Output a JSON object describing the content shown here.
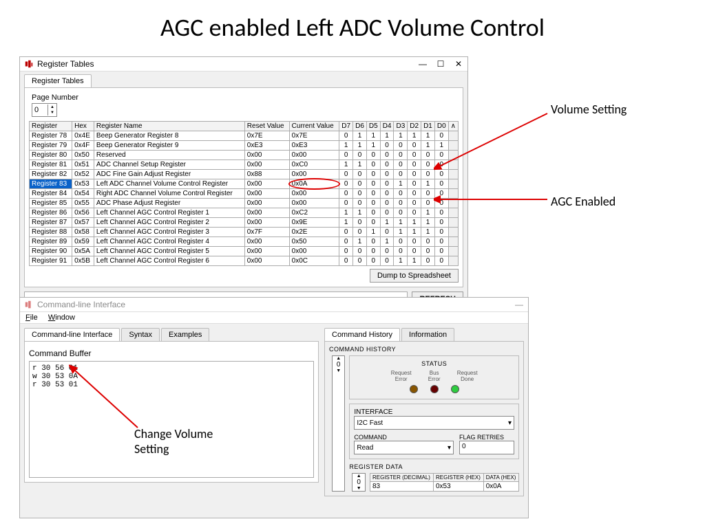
{
  "slide_title": "AGC enabled Left ADC Volume Control",
  "annotations": {
    "volume_setting": "Volume Setting",
    "agc_enabled": "AGC Enabled",
    "change_volume": "Change Volume Setting"
  },
  "reg_window": {
    "title": "Register Tables",
    "tab": "Register Tables",
    "page_label": "Page Number",
    "page_value": "0",
    "dump_btn": "Dump to Spreadsheet",
    "refresh_btn": "REFRESH",
    "columns": [
      "Register",
      "Hex",
      "Register Name",
      "Reset Value",
      "Current Value",
      "D7",
      "D6",
      "D5",
      "D4",
      "D3",
      "D2",
      "D1",
      "D0"
    ],
    "rows": [
      {
        "reg": "Register 78",
        "hex": "0x4E",
        "name": "Beep Generator Register 8",
        "reset": "0x7E",
        "cur": "0x7E",
        "bits": [
          "0",
          "1",
          "1",
          "1",
          "1",
          "1",
          "1",
          "0"
        ]
      },
      {
        "reg": "Register 79",
        "hex": "0x4F",
        "name": "Beep Generator Register 9",
        "reset": "0xE3",
        "cur": "0xE3",
        "bits": [
          "1",
          "1",
          "1",
          "0",
          "0",
          "0",
          "1",
          "1"
        ]
      },
      {
        "reg": "Register 80",
        "hex": "0x50",
        "name": "Reserved",
        "reset": "0x00",
        "cur": "0x00",
        "bits": [
          "0",
          "0",
          "0",
          "0",
          "0",
          "0",
          "0",
          "0"
        ]
      },
      {
        "reg": "Register 81",
        "hex": "0x51",
        "name": "ADC Channel Setup Register",
        "reset": "0x00",
        "cur": "0xC0",
        "bits": [
          "1",
          "1",
          "0",
          "0",
          "0",
          "0",
          "0",
          "0"
        ]
      },
      {
        "reg": "Register 82",
        "hex": "0x52",
        "name": "ADC Fine Gain Adjust Register",
        "reset": "0x88",
        "cur": "0x00",
        "bits": [
          "0",
          "0",
          "0",
          "0",
          "0",
          "0",
          "0",
          "0"
        ]
      },
      {
        "reg": "Register 83",
        "hex": "0x53",
        "name": "Left ADC Channel Volume Control Register",
        "reset": "0x00",
        "cur": "0x0A",
        "bits": [
          "0",
          "0",
          "0",
          "0",
          "1",
          "0",
          "1",
          "0"
        ],
        "selected": true,
        "circled": true
      },
      {
        "reg": "Register 84",
        "hex": "0x54",
        "name": "Right ADC Channel Volume Control Register",
        "reset": "0x00",
        "cur": "0x00",
        "bits": [
          "0",
          "0",
          "0",
          "0",
          "0",
          "0",
          "0",
          "0"
        ]
      },
      {
        "reg": "Register 85",
        "hex": "0x55",
        "name": "ADC Phase Adjust Register",
        "reset": "0x00",
        "cur": "0x00",
        "bits": [
          "0",
          "0",
          "0",
          "0",
          "0",
          "0",
          "0",
          "0"
        ]
      },
      {
        "reg": "Register 86",
        "hex": "0x56",
        "name": "Left Channel AGC Control Register 1",
        "reset": "0x00",
        "cur": "0xC2",
        "bits": [
          "1",
          "1",
          "0",
          "0",
          "0",
          "0",
          "1",
          "0"
        ]
      },
      {
        "reg": "Register 87",
        "hex": "0x57",
        "name": "Left Channel AGC Control Register 2",
        "reset": "0x00",
        "cur": "0x9E",
        "bits": [
          "1",
          "0",
          "0",
          "1",
          "1",
          "1",
          "1",
          "0"
        ]
      },
      {
        "reg": "Register 88",
        "hex": "0x58",
        "name": "Left Channel AGC Control Register 3",
        "reset": "0x7F",
        "cur": "0x2E",
        "bits": [
          "0",
          "0",
          "1",
          "0",
          "1",
          "1",
          "1",
          "0"
        ]
      },
      {
        "reg": "Register 89",
        "hex": "0x59",
        "name": "Left Channel AGC Control Register 4",
        "reset": "0x00",
        "cur": "0x50",
        "bits": [
          "0",
          "1",
          "0",
          "1",
          "0",
          "0",
          "0",
          "0"
        ]
      },
      {
        "reg": "Register 90",
        "hex": "0x5A",
        "name": "Left Channel AGC Control Register 5",
        "reset": "0x00",
        "cur": "0x00",
        "bits": [
          "0",
          "0",
          "0",
          "0",
          "0",
          "0",
          "0",
          "0"
        ]
      },
      {
        "reg": "Register 91",
        "hex": "0x5B",
        "name": "Left Channel AGC Control Register 6",
        "reset": "0x00",
        "cur": "0x0C",
        "bits": [
          "0",
          "0",
          "0",
          "0",
          "1",
          "1",
          "0",
          "0"
        ]
      }
    ]
  },
  "cli_window": {
    "title": "Command-line Interface",
    "menu": {
      "file": "File",
      "window": "Window"
    },
    "tabs": {
      "cli": "Command-line Interface",
      "syntax": "Syntax",
      "examples": "Examples"
    },
    "buffer_label": "Command Buffer",
    "buffer_lines": [
      "r 30 56 01",
      "w 30 53 0A",
      "r 30 53 01"
    ],
    "history_tab": "Command History",
    "info_tab": "Information",
    "history_title": "COMMAND HISTORY",
    "history_idx": "0",
    "status_title": "STATUS",
    "status_labels": [
      "Request Error",
      "Bus Error",
      "Request Done"
    ],
    "interface_label": "INTERFACE",
    "interface_value": "I2C Fast",
    "command_label": "COMMAND",
    "command_value": "Read",
    "flag_label": "FLAG RETRIES",
    "flag_value": "0",
    "regdata_label": "REGISTER DATA",
    "regdata_idx": "0",
    "regdata_cols": [
      "REGISTER (DECIMAL)",
      "REGISTER (HEX)",
      "DATA (HEX)"
    ],
    "regdata_vals": [
      "83",
      "0x53",
      "0x0A"
    ]
  }
}
